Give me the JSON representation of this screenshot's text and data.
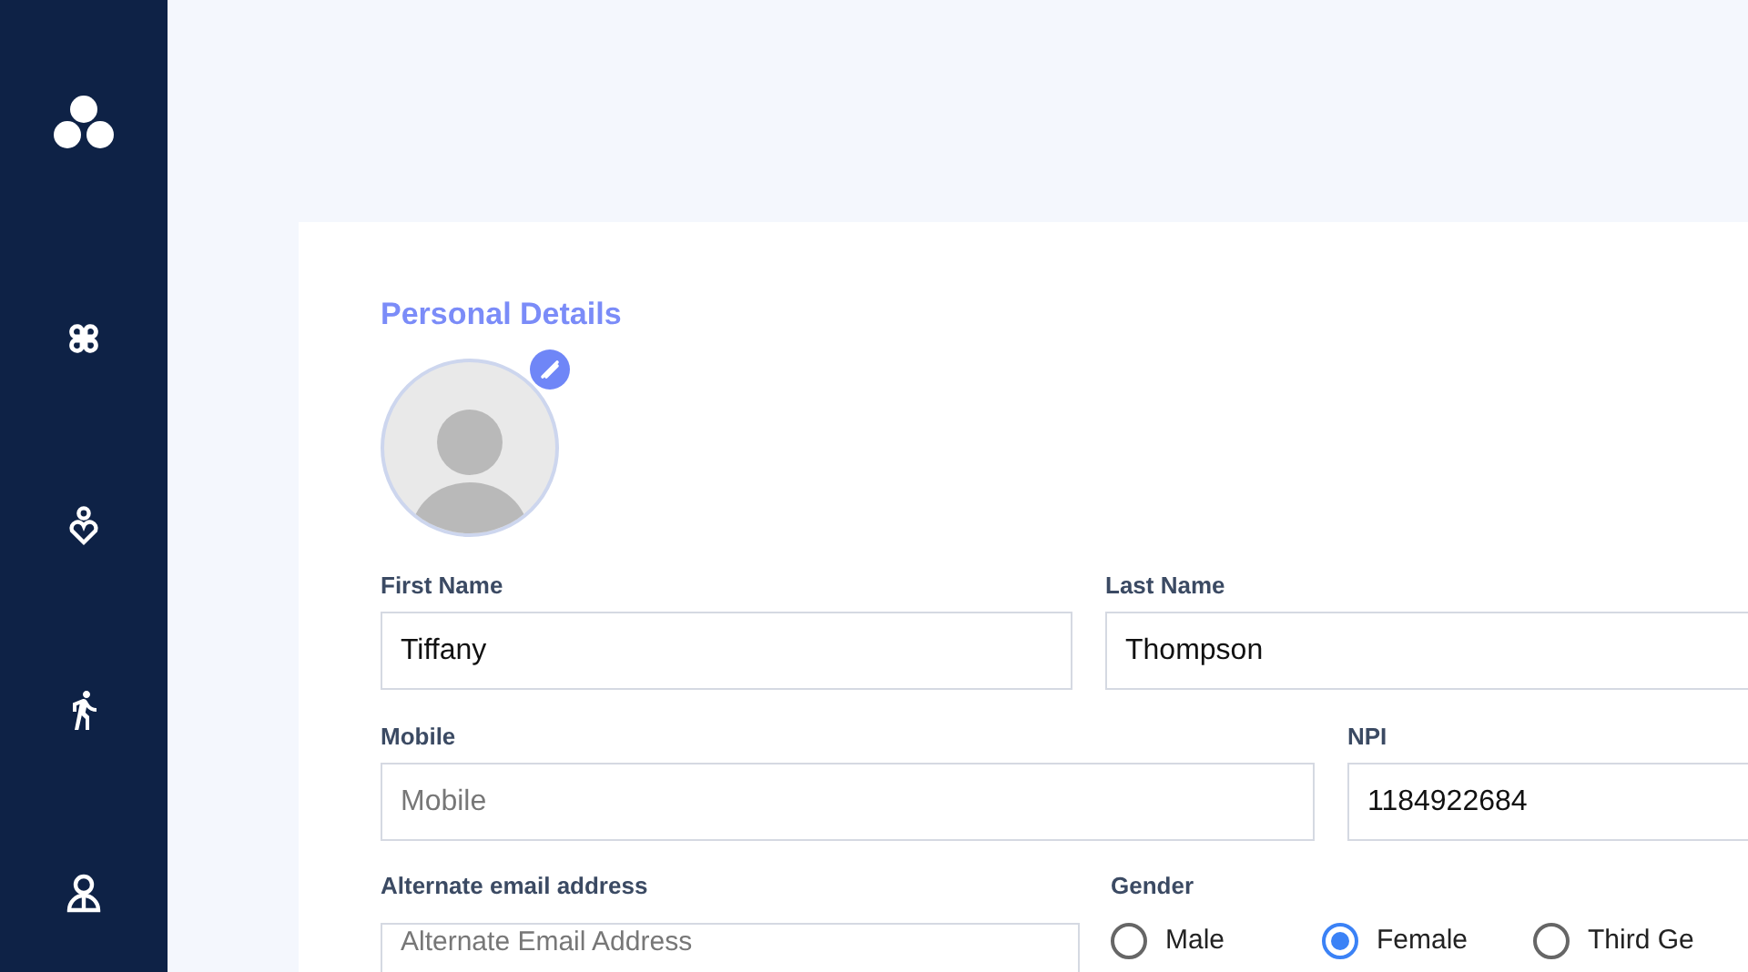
{
  "section_title": "Personal Details",
  "fields": [
    {
      "label": "First Name",
      "value": "Tiffany"
    },
    {
      "label": "Last Name",
      "value": "Thompson"
    },
    {
      "label": "Mobile",
      "placeholder": "Mobile"
    },
    {
      "label": "NPI",
      "value": "1184922684"
    },
    {
      "label": "Alternate email address",
      "placeholder": "Alternate Email Address"
    }
  ],
  "gender": {
    "label": "Gender",
    "options": [
      {
        "label": "Male",
        "selected": false
      },
      {
        "label": "Female",
        "selected": true
      },
      {
        "label": "Third Ge",
        "selected": false
      }
    ]
  }
}
